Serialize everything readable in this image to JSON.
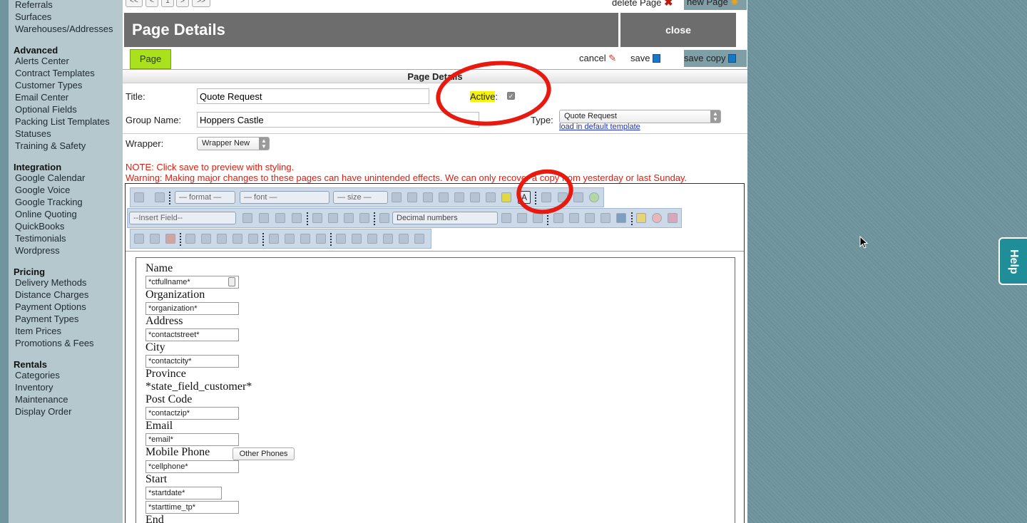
{
  "sidebar": {
    "items_top": [
      "Referrals",
      "Surfaces",
      "Warehouses/Addresses"
    ],
    "sections": [
      {
        "title": "Advanced",
        "items": [
          "Alerts Center",
          "Contract Templates",
          "Customer Types",
          "Email Center",
          "Optional Fields",
          "Packing List Templates",
          "Statuses",
          "Training & Safety"
        ]
      },
      {
        "title": "Integration",
        "items": [
          "Google Calendar",
          "Google Voice",
          "Google Tracking",
          "Online Quoting",
          "QuickBooks",
          "Testimonials",
          "Wordpress"
        ]
      },
      {
        "title": "Pricing",
        "items": [
          "Delivery Methods",
          "Distance Charges",
          "Payment Options",
          "Payment Types",
          "Item Prices",
          "Promotions & Fees"
        ]
      },
      {
        "title": "Rentals",
        "items": [
          "Categories",
          "Inventory",
          "Maintenance",
          "Display Order"
        ]
      }
    ]
  },
  "pager": {
    "first": "<<",
    "prev": "<",
    "page": "1",
    "next": ">",
    "last": ">>"
  },
  "top_actions": {
    "delete": "delete Page",
    "new": "new Page"
  },
  "header": {
    "title": "Page Details",
    "close": "close"
  },
  "tabs": {
    "page": "Page"
  },
  "actions": {
    "cancel": "cancel",
    "save": "save",
    "save_copy": "save copy"
  },
  "section_title": "Page Details",
  "form": {
    "title_label": "Title:",
    "title_value": "Quote Request",
    "active_label": "Active",
    "active_colon": ":",
    "group_label": "Group Name:",
    "group_value": "Hoppers Castle",
    "type_label": "Type:",
    "type_value": "Quote Request",
    "load_template": "load in default template",
    "wrapper_label": "Wrapper:",
    "wrapper_value": "Wrapper New"
  },
  "notes": {
    "note": "NOTE: Click save to preview with styling.",
    "warning": "Warning: Making major changes to these pages can have unintended effects. We can only recover a copy from yesterday or last Sunday."
  },
  "toolbar": {
    "format": "— format —",
    "font": "— font —",
    "size": "— size —",
    "insert_field": "--Insert Field--",
    "list_style": "Decimal numbers"
  },
  "document": {
    "name_label": "Name",
    "name_field": "*ctfullname*",
    "org_label": "Organization",
    "org_field": "*organization*",
    "address_label": "Address",
    "address_field": "*contactstreet*",
    "city_label": "City",
    "city_field": "*contactcity*",
    "province_label": "Province",
    "province_field": "*state_field_customer*",
    "postcode_label": "Post Code",
    "postcode_field": "*contactzip*",
    "email_label": "Email",
    "email_field": "*email*",
    "mobile_label": "Mobile Phone",
    "other_phones": "Other Phones",
    "mobile_field": "*cellphone*",
    "start_label": "Start",
    "startdate_field": "*startdate*",
    "starttime_field": "*starttime_tp*",
    "end_label": "End"
  },
  "help": "Help",
  "colors": {
    "accent_green": "#a9e11c",
    "header_gray": "#6d6d6d",
    "warning_red": "#e11c0e",
    "annotation_red": "#e8190f",
    "help_teal": "#1f8e98"
  }
}
